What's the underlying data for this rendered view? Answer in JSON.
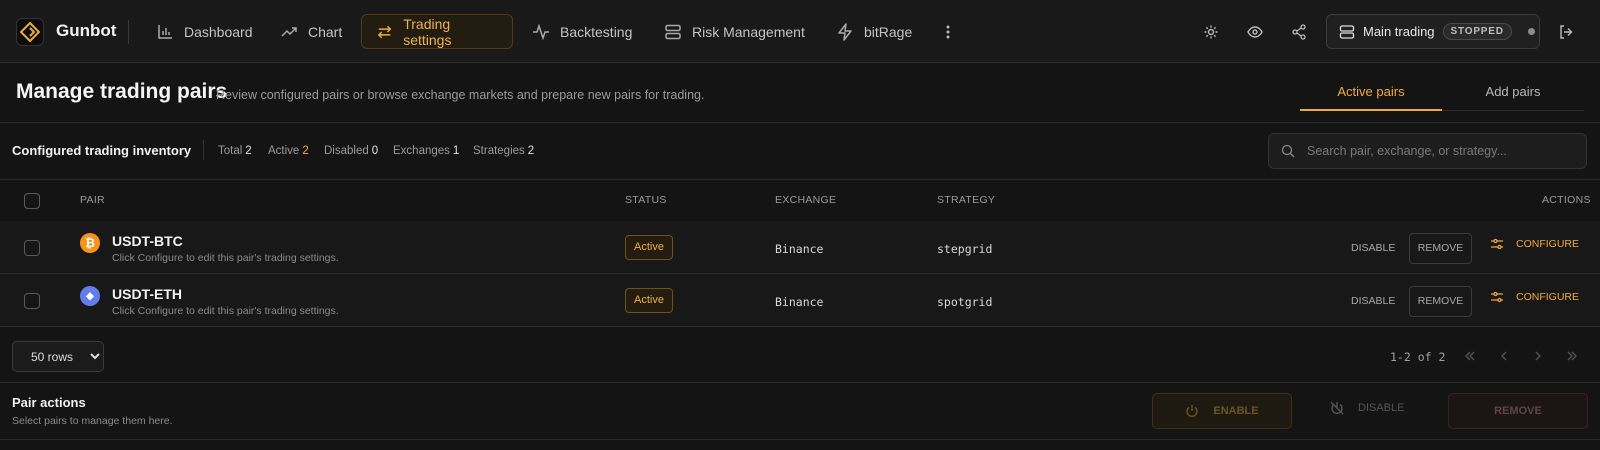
{
  "app": {
    "name": "Gunbot"
  },
  "nav": {
    "items": [
      {
        "label": "Dashboard",
        "icon": "bar-chart-icon"
      },
      {
        "label": "Chart",
        "icon": "trend-icon"
      },
      {
        "label": "Trading settings",
        "icon": "swap-arrows-icon",
        "active": true
      },
      {
        "label": "Backtesting",
        "icon": "pulse-icon"
      },
      {
        "label": "Risk Management",
        "icon": "server-icon"
      },
      {
        "label": "bitRage",
        "icon": "lightning-icon"
      }
    ],
    "mode_label": "Main trading",
    "mode_status": "STOPPED"
  },
  "header": {
    "title": "Manage trading pairs",
    "subtitle": "Review configured pairs or browse exchange markets and prepare new pairs for trading.",
    "tabs": [
      {
        "label": "Active pairs",
        "active": true
      },
      {
        "label": "Add pairs"
      }
    ]
  },
  "inventory": {
    "title": "Configured trading inventory",
    "stats": [
      {
        "label": "Total",
        "value": "2"
      },
      {
        "label": "Active",
        "value": "2"
      },
      {
        "label": "Disabled",
        "value": "0"
      },
      {
        "label": "Exchanges",
        "value": "1"
      },
      {
        "label": "Strategies",
        "value": "2"
      }
    ],
    "search_placeholder": "Search pair, exchange, or strategy..."
  },
  "table": {
    "columns": {
      "pair": "PAIR",
      "status": "STATUS",
      "exchange": "EXCHANGE",
      "strategy": "STRATEGY",
      "actions": "ACTIONS"
    },
    "rows": [
      {
        "pair": "USDT-BTC",
        "coin": "btc",
        "coin_glyph": "₿",
        "coin_color": "#f7931a",
        "desc": "Click Configure to edit this pair's trading settings.",
        "status": "Active",
        "exchange": "Binance",
        "strategy": "stepgrid"
      },
      {
        "pair": "USDT-ETH",
        "coin": "eth",
        "coin_glyph": "◆",
        "coin_color": "#627eea",
        "desc": "Click Configure to edit this pair's trading settings.",
        "status": "Active",
        "exchange": "Binance",
        "strategy": "spotgrid"
      }
    ],
    "row_actions": {
      "disable": "DISABLE",
      "remove": "REMOVE",
      "configure": "CONFIGURE"
    }
  },
  "pagination": {
    "rows_option": "50 rows",
    "info": "1-2 of 2"
  },
  "pair_actions": {
    "title": "Pair actions",
    "subtitle": "Select pairs to manage them here.",
    "enable": "ENABLE",
    "disable": "DISABLE",
    "remove": "REMOVE"
  },
  "colors": {
    "accent": "#f0a940",
    "background": "#141414",
    "btc": "#f7931a",
    "eth": "#627eea"
  }
}
